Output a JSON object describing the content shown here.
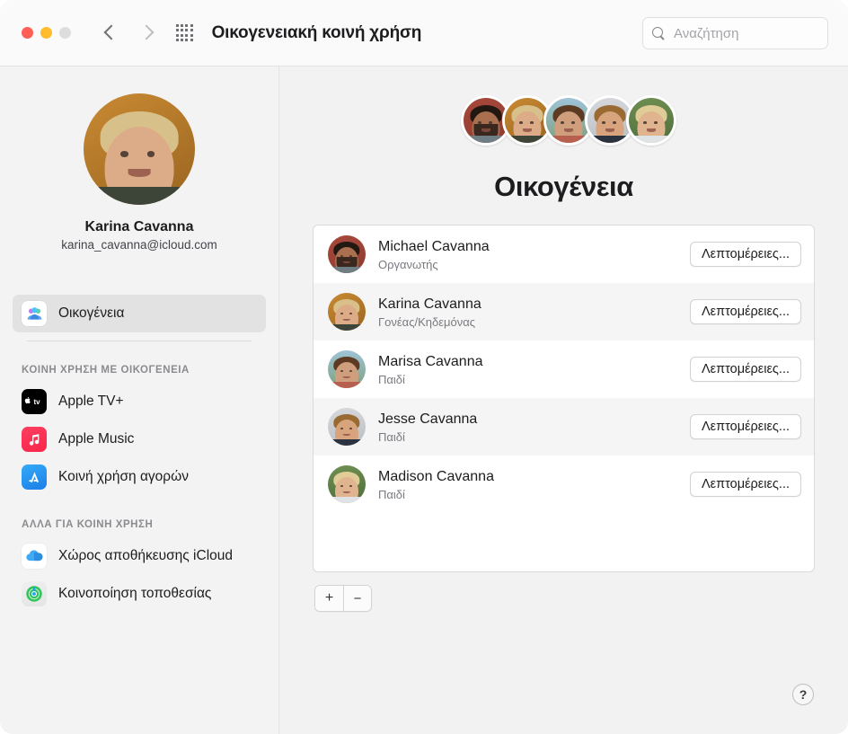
{
  "window": {
    "title": "Οικογενειακή κοινή χρήση",
    "traffic_lights": {
      "close_color": "#FF5F57",
      "minimize_color": "#FFBD2E",
      "zoom_color": "#DDDDDD"
    },
    "back_label": "Πίσω",
    "forward_label": "Μπροστά",
    "grid_label": "Προβολή όλων"
  },
  "search": {
    "placeholder": "Αναζήτηση",
    "value": ""
  },
  "sidebar": {
    "account": {
      "name": "Karina Cavanna",
      "email": "karina_cavanna@icloud.com"
    },
    "primary_item": {
      "label": "Οικογένεια",
      "icon": "family-icon",
      "selected": true
    },
    "sections": [
      {
        "title": "ΚΟΙΝΗ ΧΡΗΣΗ ΜΕ ΟΙΚΟΓΕΝΕΙΑ",
        "items": [
          {
            "label": "Apple TV+",
            "icon": "apple-tv-icon"
          },
          {
            "label": "Apple Music",
            "icon": "apple-music-icon"
          },
          {
            "label": "Κοινή χρήση αγορών",
            "icon": "app-store-icon"
          }
        ]
      },
      {
        "title": "ΑΛΛΑ ΓΙΑ ΚΟΙΝΗ ΧΡΗΣΗ",
        "items": [
          {
            "label": "Χώρος αποθήκευσης iCloud",
            "icon": "icloud-icon"
          },
          {
            "label": "Κοινοποίηση τοποθεσίας",
            "icon": "find-my-icon"
          }
        ]
      }
    ]
  },
  "main": {
    "heading": "Οικογένεια",
    "cluster_avatars": [
      "Michael Cavanna",
      "Karina Cavanna",
      "Marisa Cavanna",
      "Jesse Cavanna",
      "Madison Cavanna"
    ],
    "members": [
      {
        "name": "Michael Cavanna",
        "role": "Οργανωτής",
        "button": "Λεπτομέρειες..."
      },
      {
        "name": "Karina Cavanna",
        "role": "Γονέας/Κηδεμόνας",
        "button": "Λεπτομέρειες..."
      },
      {
        "name": "Marisa Cavanna",
        "role": "Παιδί",
        "button": "Λεπτομέρειες..."
      },
      {
        "name": "Jesse Cavanna",
        "role": "Παιδί",
        "button": "Λεπτομέρειες..."
      },
      {
        "name": "Madison Cavanna",
        "role": "Παιδί",
        "button": "Λεπτομέρειες..."
      }
    ],
    "add_label": "+",
    "remove_label": "−",
    "help_label": "?"
  }
}
